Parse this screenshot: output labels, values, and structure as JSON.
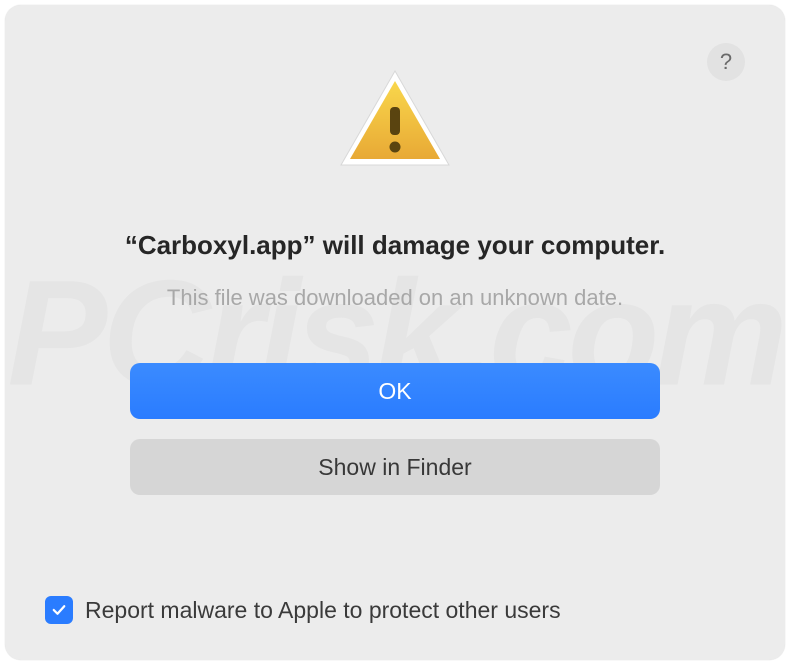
{
  "dialog": {
    "help_tooltip": "?",
    "title": "“Carboxyl.app” will damage your computer.",
    "subtitle": "This file was downloaded on an unknown date.",
    "primary_button": "OK",
    "secondary_button": "Show in Finder",
    "checkbox_label": "Report malware to Apple to protect other users",
    "checkbox_checked": true
  },
  "watermark": "PCrisk.com"
}
